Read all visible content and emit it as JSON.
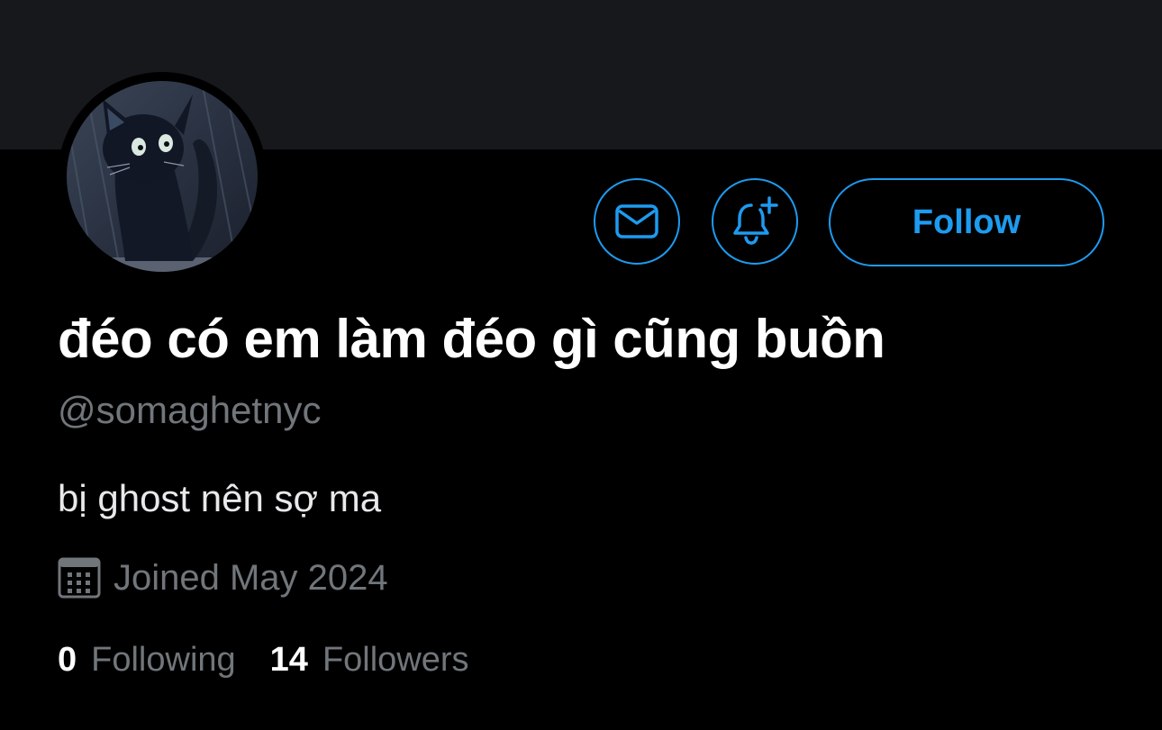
{
  "profile": {
    "display_name": "đéo có em làm đéo gì cũng buồn",
    "handle": "@somaghetnyc",
    "bio": "bị ghost nên sợ ma",
    "joined": "Joined May 2024",
    "avatar_icon": "black-cat-avatar"
  },
  "actions": {
    "message_icon": "mail-icon",
    "notify_icon": "bell-plus-icon",
    "follow_label": "Follow"
  },
  "stats": {
    "following_count": "0",
    "following_label": "Following",
    "followers_count": "14",
    "followers_label": "Followers"
  },
  "colors": {
    "background": "#000000",
    "banner": "#16181c",
    "accent": "#1d9bf0",
    "secondary_text": "#71767b",
    "primary_text": "#ffffff"
  }
}
